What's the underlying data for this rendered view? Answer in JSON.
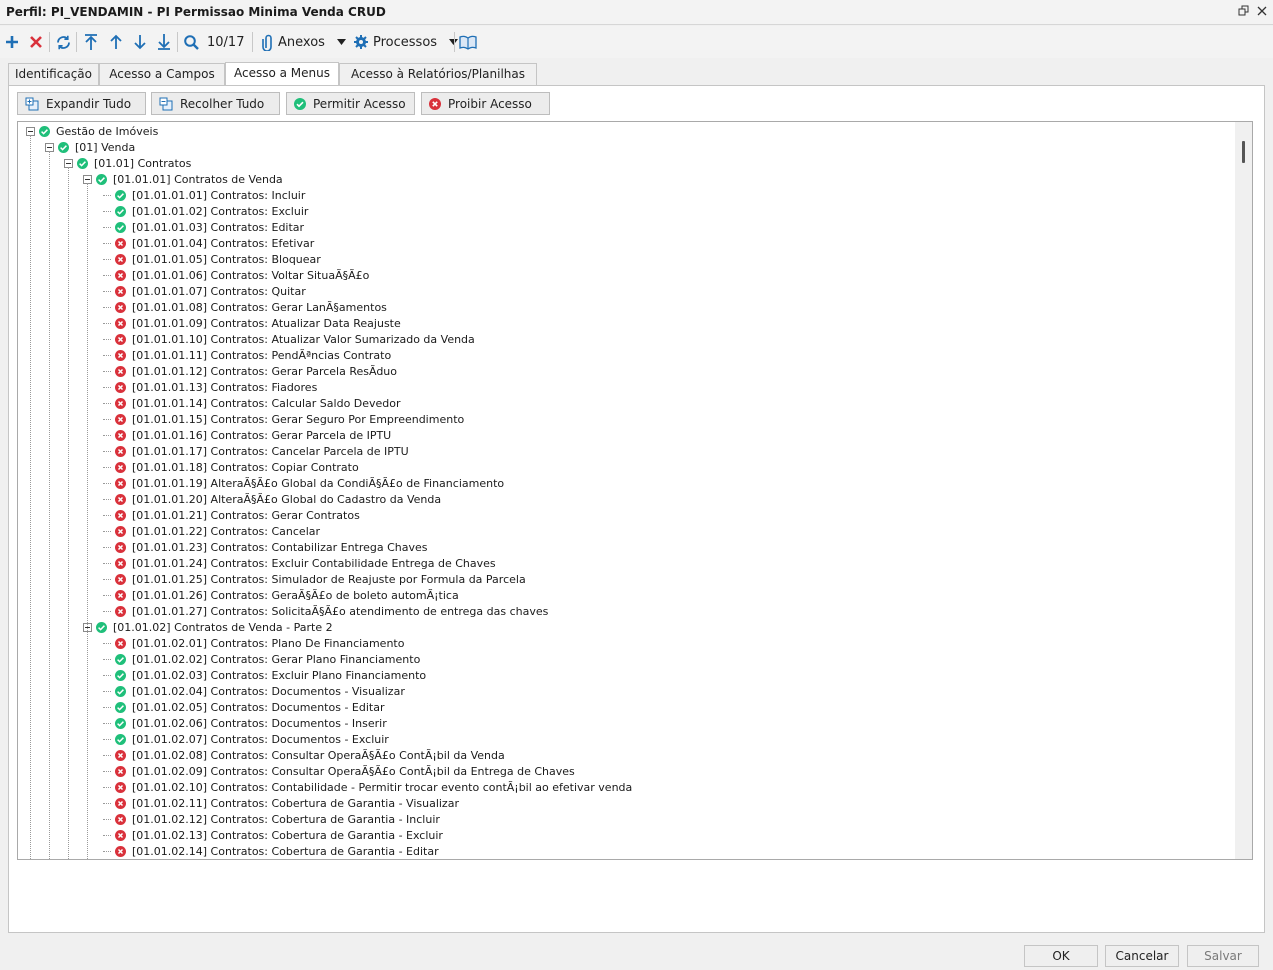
{
  "window": {
    "title": "Perfil: PI_VENDAMIN - PI Permissao Minima Venda CRUD"
  },
  "toolbar": {
    "record_counter": "10/17",
    "attachments_label": "Anexos",
    "processes_label": "Processos"
  },
  "tabs": [
    {
      "label": "Identificação",
      "active": false
    },
    {
      "label": "Acesso a Campos",
      "active": false
    },
    {
      "label": "Acesso a Menus",
      "active": true
    },
    {
      "label": "Acesso à Relatórios/Planilhas",
      "active": false
    }
  ],
  "actions": {
    "expand_all": "Expandir Tudo",
    "collapse_all": "Recolher Tudo",
    "allow_access": "Permitir Acesso",
    "deny_access": "Proibir Acesso"
  },
  "colors": {
    "allowed": "#1fbf7a",
    "denied": "#d9313b"
  },
  "tree": [
    {
      "level": 0,
      "node": "parent",
      "status": "allowed",
      "label": "Gestão de Imóveis"
    },
    {
      "level": 1,
      "node": "parent",
      "status": "allowed",
      "label": "[01] Venda"
    },
    {
      "level": 2,
      "node": "parent",
      "status": "allowed",
      "label": "[01.01] Contratos"
    },
    {
      "level": 3,
      "node": "parent",
      "status": "allowed",
      "label": "[01.01.01] Contratos de Venda"
    },
    {
      "level": 4,
      "node": "leaf",
      "status": "allowed",
      "label": "[01.01.01.01] Contratos: Incluir"
    },
    {
      "level": 4,
      "node": "leaf",
      "status": "allowed",
      "label": "[01.01.01.02] Contratos: Excluir"
    },
    {
      "level": 4,
      "node": "leaf",
      "status": "allowed",
      "label": "[01.01.01.03] Contratos: Editar"
    },
    {
      "level": 4,
      "node": "leaf",
      "status": "denied",
      "label": "[01.01.01.04] Contratos: Efetivar"
    },
    {
      "level": 4,
      "node": "leaf",
      "status": "denied",
      "label": "[01.01.01.05] Contratos: Bloquear"
    },
    {
      "level": 4,
      "node": "leaf",
      "status": "denied",
      "label": "[01.01.01.06] Contratos: Voltar SituaÃ§Ã£o"
    },
    {
      "level": 4,
      "node": "leaf",
      "status": "denied",
      "label": "[01.01.01.07] Contratos: Quitar"
    },
    {
      "level": 4,
      "node": "leaf",
      "status": "denied",
      "label": "[01.01.01.08] Contratos: Gerar LanÃ§amentos"
    },
    {
      "level": 4,
      "node": "leaf",
      "status": "denied",
      "label": "[01.01.01.09] Contratos: Atualizar Data Reajuste"
    },
    {
      "level": 4,
      "node": "leaf",
      "status": "denied",
      "label": "[01.01.01.10] Contratos: Atualizar Valor Sumarizado da Venda"
    },
    {
      "level": 4,
      "node": "leaf",
      "status": "denied",
      "label": "[01.01.01.11] Contratos: PendÃªncias Contrato"
    },
    {
      "level": 4,
      "node": "leaf",
      "status": "denied",
      "label": "[01.01.01.12] Contratos: Gerar Parcela ResÃ­duo"
    },
    {
      "level": 4,
      "node": "leaf",
      "status": "denied",
      "label": "[01.01.01.13] Contratos: Fiadores"
    },
    {
      "level": 4,
      "node": "leaf",
      "status": "denied",
      "label": "[01.01.01.14] Contratos: Calcular Saldo Devedor"
    },
    {
      "level": 4,
      "node": "leaf",
      "status": "denied",
      "label": "[01.01.01.15] Contratos: Gerar Seguro Por Empreendimento"
    },
    {
      "level": 4,
      "node": "leaf",
      "status": "denied",
      "label": "[01.01.01.16] Contratos: Gerar Parcela de IPTU"
    },
    {
      "level": 4,
      "node": "leaf",
      "status": "denied",
      "label": "[01.01.01.17] Contratos: Cancelar Parcela de IPTU"
    },
    {
      "level": 4,
      "node": "leaf",
      "status": "denied",
      "label": "[01.01.01.18] Contratos: Copiar Contrato"
    },
    {
      "level": 4,
      "node": "leaf",
      "status": "denied",
      "label": "[01.01.01.19] AlteraÃ§Ã£o Global da CondiÃ§Ã£o de Financiamento"
    },
    {
      "level": 4,
      "node": "leaf",
      "status": "denied",
      "label": "[01.01.01.20] AlteraÃ§Ã£o Global do Cadastro da Venda"
    },
    {
      "level": 4,
      "node": "leaf",
      "status": "denied",
      "label": "[01.01.01.21] Contratos: Gerar Contratos"
    },
    {
      "level": 4,
      "node": "leaf",
      "status": "denied",
      "label": "[01.01.01.22] Contratos: Cancelar"
    },
    {
      "level": 4,
      "node": "leaf",
      "status": "denied",
      "label": "[01.01.01.23] Contratos: Contabilizar Entrega Chaves"
    },
    {
      "level": 4,
      "node": "leaf",
      "status": "denied",
      "label": "[01.01.01.24] Contratos: Excluir Contabilidade Entrega de Chaves"
    },
    {
      "level": 4,
      "node": "leaf",
      "status": "denied",
      "label": "[01.01.01.25] Contratos: Simulador de Reajuste por Formula da Parcela"
    },
    {
      "level": 4,
      "node": "leaf",
      "status": "denied",
      "label": "[01.01.01.26] Contratos: GeraÃ§Ã£o de boleto automÃ¡tica"
    },
    {
      "level": 4,
      "node": "leaf",
      "status": "denied",
      "label": "[01.01.01.27] Contratos: SolicitaÃ§Ã£o atendimento de entrega das chaves"
    },
    {
      "level": 3,
      "node": "parent",
      "status": "allowed",
      "label": "[01.01.02] Contratos de Venda - Parte 2"
    },
    {
      "level": 4,
      "node": "leaf",
      "status": "denied",
      "label": "[01.01.02.01] Contratos: Plano De Financiamento"
    },
    {
      "level": 4,
      "node": "leaf",
      "status": "allowed",
      "label": "[01.01.02.02] Contratos: Gerar Plano Financiamento"
    },
    {
      "level": 4,
      "node": "leaf",
      "status": "allowed",
      "label": "[01.01.02.03] Contratos: Excluir Plano Financiamento"
    },
    {
      "level": 4,
      "node": "leaf",
      "status": "allowed",
      "label": "[01.01.02.04] Contratos: Documentos - Visualizar"
    },
    {
      "level": 4,
      "node": "leaf",
      "status": "allowed",
      "label": "[01.01.02.05] Contratos: Documentos - Editar"
    },
    {
      "level": 4,
      "node": "leaf",
      "status": "allowed",
      "label": "[01.01.02.06] Contratos: Documentos - Inserir"
    },
    {
      "level": 4,
      "node": "leaf",
      "status": "allowed",
      "label": "[01.01.02.07] Contratos: Documentos - Excluir"
    },
    {
      "level": 4,
      "node": "leaf",
      "status": "denied",
      "label": "[01.01.02.08] Contratos: Consultar OperaÃ§Ã£o ContÃ¡bil da Venda"
    },
    {
      "level": 4,
      "node": "leaf",
      "status": "denied",
      "label": "[01.01.02.09] Contratos: Consultar OperaÃ§Ã£o ContÃ¡bil da Entrega de Chaves"
    },
    {
      "level": 4,
      "node": "leaf",
      "status": "denied",
      "label": "[01.01.02.10] Contratos: Contabilidade - Permitir trocar evento contÃ¡bil ao efetivar venda"
    },
    {
      "level": 4,
      "node": "leaf",
      "status": "denied",
      "label": "[01.01.02.11] Contratos: Cobertura de Garantia - Visualizar"
    },
    {
      "level": 4,
      "node": "leaf",
      "status": "denied",
      "label": "[01.01.02.12] Contratos: Cobertura de Garantia - Incluir"
    },
    {
      "level": 4,
      "node": "leaf",
      "status": "denied",
      "label": "[01.01.02.13] Contratos: Cobertura de Garantia - Excluir"
    },
    {
      "level": 4,
      "node": "leaf",
      "status": "denied",
      "label": "[01.01.02.14] Contratos: Cobertura de Garantia - Editar"
    }
  ],
  "footer": {
    "ok": "OK",
    "cancel": "Cancelar",
    "save": "Salvar"
  }
}
